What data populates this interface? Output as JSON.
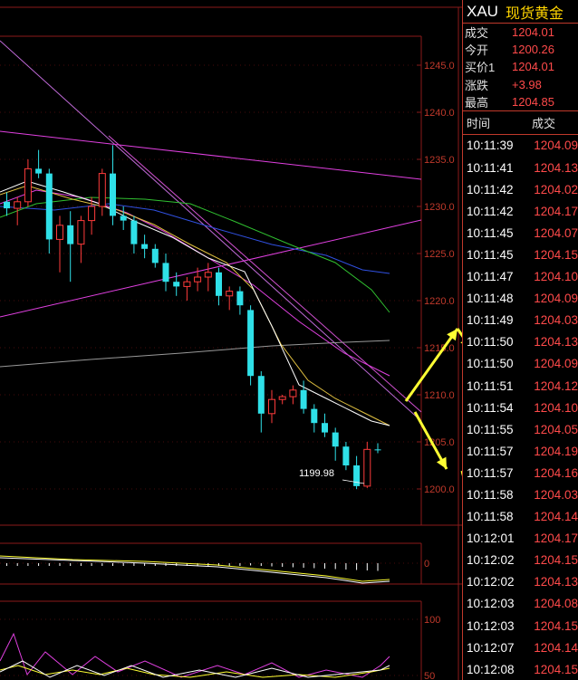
{
  "header": {
    "symbol": "XAU",
    "name": "现货黄金"
  },
  "quote": [
    {
      "label": "成交",
      "value": "1204.01"
    },
    {
      "label": "今开",
      "value": "1200.26"
    },
    {
      "label": "买价1",
      "value": "1204.01"
    },
    {
      "label": "涨跌",
      "value": "+3.98"
    },
    {
      "label": "最高",
      "value": "1204.85"
    }
  ],
  "ticks_header": {
    "time": "时间",
    "price": "成交"
  },
  "ticks": [
    {
      "time": "10:11:39",
      "price": "1204.09"
    },
    {
      "time": "10:11:41",
      "price": "1204.13"
    },
    {
      "time": "10:11:42",
      "price": "1204.02"
    },
    {
      "time": "10:11:42",
      "price": "1204.17"
    },
    {
      "time": "10:11:45",
      "price": "1204.07"
    },
    {
      "time": "10:11:45",
      "price": "1204.15"
    },
    {
      "time": "10:11:47",
      "price": "1204.10"
    },
    {
      "time": "10:11:48",
      "price": "1204.09"
    },
    {
      "time": "10:11:49",
      "price": "1204.03"
    },
    {
      "time": "10:11:50",
      "price": "1204.13"
    },
    {
      "time": "10:11:50",
      "price": "1204.09"
    },
    {
      "time": "10:11:51",
      "price": "1204.12"
    },
    {
      "time": "10:11:54",
      "price": "1204.10"
    },
    {
      "time": "10:11:55",
      "price": "1204.05"
    },
    {
      "time": "10:11:57",
      "price": "1204.19"
    },
    {
      "time": "10:11:57",
      "price": "1204.16"
    },
    {
      "time": "10:11:58",
      "price": "1204.03"
    },
    {
      "time": "10:11:58",
      "price": "1204.14"
    },
    {
      "time": "10:12:01",
      "price": "1204.17"
    },
    {
      "time": "10:12:02",
      "price": "1204.15"
    },
    {
      "time": "10:12:02",
      "price": "1204.13"
    },
    {
      "time": "10:12:03",
      "price": "1204.08"
    },
    {
      "time": "10:12:03",
      "price": "1204.15"
    },
    {
      "time": "10:12:07",
      "price": "1204.14"
    },
    {
      "time": "10:12:08",
      "price": "1204.15"
    }
  ],
  "chart": {
    "price_axis": [
      "1245.0",
      "1240.0",
      "1235.0",
      "1230.0",
      "1225.0",
      "1220.0",
      "1215.0",
      "1210.0",
      "1205.0",
      "1200.0"
    ],
    "low_annotation": "1199.98",
    "macd_axis": [
      "0"
    ],
    "kdj_axis": [
      "100",
      "50"
    ],
    "colors": {
      "up": "#ff3b3b",
      "down": "#2fe0e8",
      "grid": "#8b1a1a",
      "arrow": "#ffff33"
    }
  },
  "candles": [
    {
      "o": 1230.5,
      "h": 1231.5,
      "l": 1229.0,
      "c": 1229.8
    },
    {
      "o": 1229.8,
      "h": 1231.0,
      "l": 1228.0,
      "c": 1230.5
    },
    {
      "o": 1230.5,
      "h": 1235.0,
      "l": 1230.0,
      "c": 1234.0
    },
    {
      "o": 1234.0,
      "h": 1236.0,
      "l": 1233.0,
      "c": 1233.5
    },
    {
      "o": 1233.5,
      "h": 1234.0,
      "l": 1225.0,
      "c": 1226.5
    },
    {
      "o": 1226.5,
      "h": 1229.0,
      "l": 1223.0,
      "c": 1228.0
    },
    {
      "o": 1228.0,
      "h": 1229.5,
      "l": 1222.0,
      "c": 1226.0
    },
    {
      "o": 1226.0,
      "h": 1229.0,
      "l": 1224.0,
      "c": 1228.5
    },
    {
      "o": 1228.5,
      "h": 1231.0,
      "l": 1227.0,
      "c": 1230.0
    },
    {
      "o": 1230.0,
      "h": 1234.0,
      "l": 1229.0,
      "c": 1233.5
    },
    {
      "o": 1233.5,
      "h": 1236.5,
      "l": 1228.0,
      "c": 1229.0
    },
    {
      "o": 1229.0,
      "h": 1230.0,
      "l": 1227.5,
      "c": 1228.5
    },
    {
      "o": 1228.5,
      "h": 1229.0,
      "l": 1225.0,
      "c": 1226.0
    },
    {
      "o": 1226.0,
      "h": 1227.0,
      "l": 1224.5,
      "c": 1225.5
    },
    {
      "o": 1225.5,
      "h": 1226.0,
      "l": 1223.5,
      "c": 1224.0
    },
    {
      "o": 1224.0,
      "h": 1225.0,
      "l": 1221.0,
      "c": 1222.0
    },
    {
      "o": 1222.0,
      "h": 1223.0,
      "l": 1220.5,
      "c": 1221.5
    },
    {
      "o": 1221.5,
      "h": 1222.5,
      "l": 1220.0,
      "c": 1222.0
    },
    {
      "o": 1222.0,
      "h": 1223.5,
      "l": 1221.0,
      "c": 1222.5
    },
    {
      "o": 1222.5,
      "h": 1224.0,
      "l": 1221.0,
      "c": 1223.0
    },
    {
      "o": 1223.0,
      "h": 1223.5,
      "l": 1219.5,
      "c": 1220.5
    },
    {
      "o": 1220.5,
      "h": 1221.5,
      "l": 1219.0,
      "c": 1221.0
    },
    {
      "o": 1221.0,
      "h": 1221.5,
      "l": 1218.5,
      "c": 1219.5
    },
    {
      "o": 1219.0,
      "h": 1219.5,
      "l": 1211.0,
      "c": 1212.0
    },
    {
      "o": 1212.0,
      "h": 1212.5,
      "l": 1206.0,
      "c": 1208.0
    },
    {
      "o": 1208.0,
      "h": 1210.5,
      "l": 1207.0,
      "c": 1209.5
    },
    {
      "o": 1209.5,
      "h": 1210.0,
      "l": 1209.0,
      "c": 1209.8
    },
    {
      "o": 1209.8,
      "h": 1211.0,
      "l": 1209.0,
      "c": 1210.5
    },
    {
      "o": 1210.5,
      "h": 1211.5,
      "l": 1208.0,
      "c": 1208.5
    },
    {
      "o": 1208.5,
      "h": 1209.0,
      "l": 1206.0,
      "c": 1207.0
    },
    {
      "o": 1207.0,
      "h": 1208.0,
      "l": 1205.5,
      "c": 1206.0
    },
    {
      "o": 1206.0,
      "h": 1206.5,
      "l": 1203.0,
      "c": 1204.5
    },
    {
      "o": 1204.5,
      "h": 1205.0,
      "l": 1202.0,
      "c": 1202.5
    },
    {
      "o": 1202.5,
      "h": 1203.5,
      "l": 1199.98,
      "c": 1200.3
    },
    {
      "o": 1200.3,
      "h": 1205.0,
      "l": 1200.1,
      "c": 1204.2
    },
    {
      "o": 1204.2,
      "h": 1204.85,
      "l": 1203.8,
      "c": 1204.1
    }
  ]
}
